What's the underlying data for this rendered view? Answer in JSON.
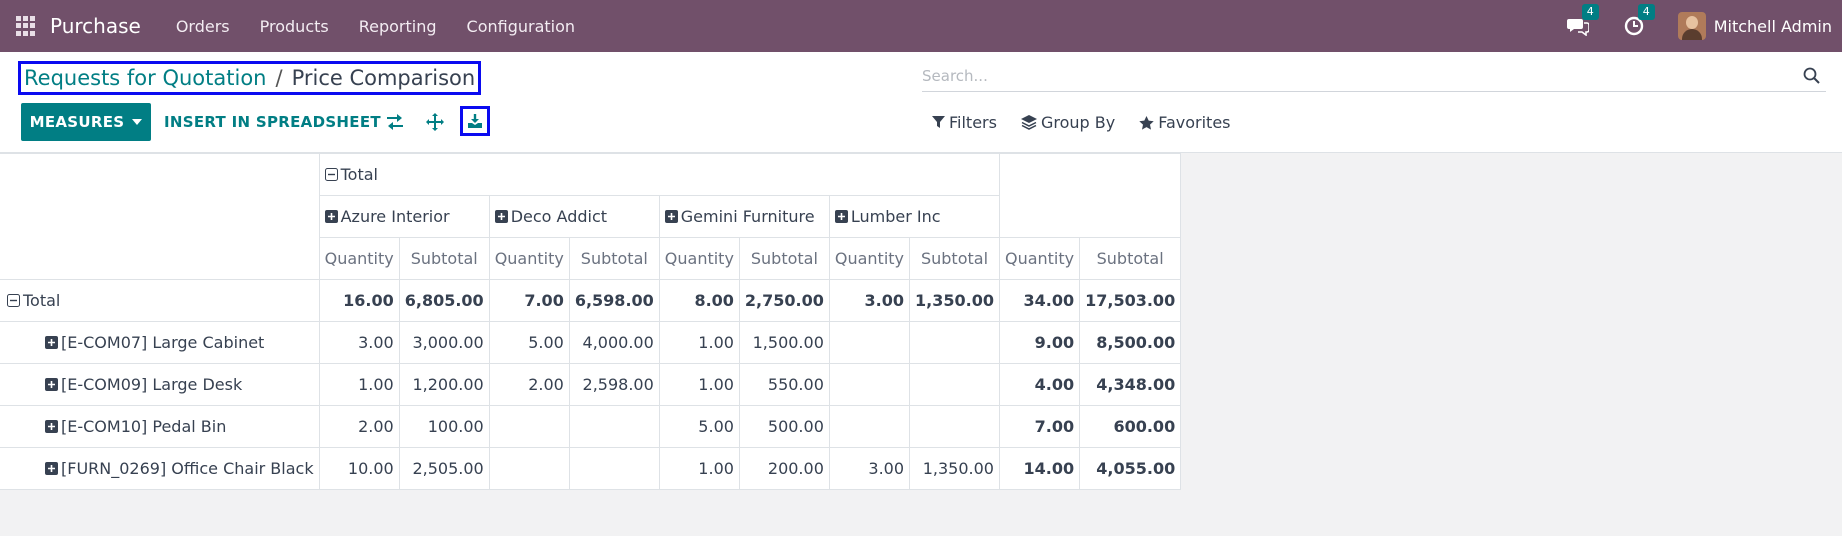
{
  "navbar": {
    "app_name": "Purchase",
    "menu": [
      "Orders",
      "Products",
      "Reporting",
      "Configuration"
    ],
    "messages_count": "4",
    "activities_count": "4",
    "user_name": "Mitchell Admin"
  },
  "breadcrumb": {
    "parent": "Requests for Quotation",
    "separator": "/",
    "current": "Price Comparison"
  },
  "search": {
    "placeholder": "Search..."
  },
  "toolbar": {
    "measures_label": "MEASURES",
    "insert_label": "INSERT IN SPREADSHEET"
  },
  "filters": {
    "filters_label": "Filters",
    "group_by_label": "Group By",
    "favorites_label": "Favorites"
  },
  "pivot": {
    "col_total_label": "Total",
    "vendors": [
      "Azure Interior",
      "Deco Addict",
      "Gemini Furniture",
      "Lumber Inc"
    ],
    "measures": [
      "Quantity",
      "Subtotal"
    ],
    "row_total_label": "Total",
    "total_row": [
      "16.00",
      "6,805.00",
      "7.00",
      "6,598.00",
      "8.00",
      "2,750.00",
      "3.00",
      "1,350.00",
      "34.00",
      "17,503.00"
    ],
    "rows": [
      {
        "label": "[E-COM07] Large Cabinet",
        "cells": [
          "3.00",
          "3,000.00",
          "5.00",
          "4,000.00",
          "1.00",
          "1,500.00",
          "",
          "",
          "9.00",
          "8,500.00"
        ]
      },
      {
        "label": "[E-COM09] Large Desk",
        "cells": [
          "1.00",
          "1,200.00",
          "2.00",
          "2,598.00",
          "1.00",
          "550.00",
          "",
          "",
          "4.00",
          "4,348.00"
        ]
      },
      {
        "label": "[E-COM10] Pedal Bin",
        "cells": [
          "2.00",
          "100.00",
          "",
          "",
          "5.00",
          "500.00",
          "",
          "",
          "7.00",
          "600.00"
        ]
      },
      {
        "label": "[FURN_0269] Office Chair Black",
        "cells": [
          "10.00",
          "2,505.00",
          "",
          "",
          "1.00",
          "200.00",
          "3.00",
          "1,350.00",
          "14.00",
          "4,055.00"
        ]
      }
    ]
  },
  "colors": {
    "navbar": "#71506a",
    "primary": "#017e84",
    "highlight_border": "#0a0af0"
  }
}
